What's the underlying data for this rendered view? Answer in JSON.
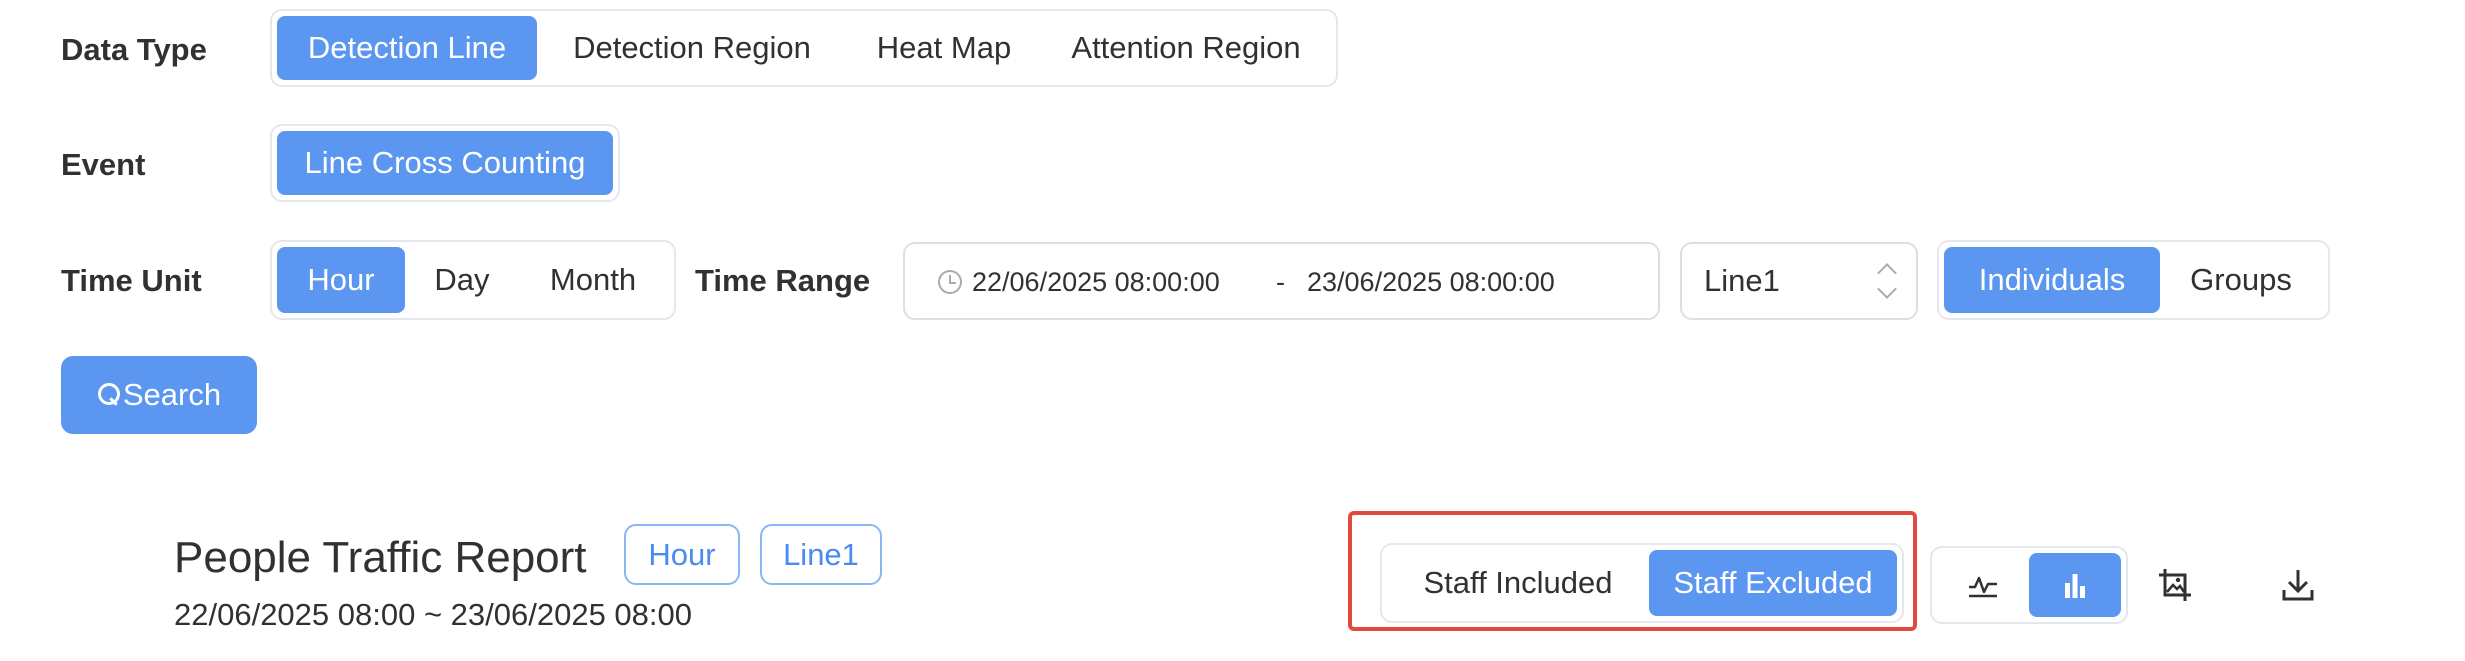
{
  "filters": {
    "data_type": {
      "label": "Data Type",
      "options": [
        "Detection Line",
        "Detection Region",
        "Heat Map",
        "Attention Region"
      ],
      "selected": "Detection Line"
    },
    "event": {
      "label": "Event",
      "options": [
        "Line Cross Counting"
      ],
      "selected": "Line Cross Counting"
    },
    "time_unit": {
      "label": "Time Unit",
      "options": [
        "Hour",
        "Day",
        "Month"
      ],
      "selected": "Hour"
    },
    "time_range": {
      "label": "Time Range",
      "start": "22/06/2025 08:00:00",
      "separator": "-",
      "end": "23/06/2025 08:00:00"
    },
    "line_select": {
      "value": "Line1"
    },
    "grouping": {
      "options": [
        "Individuals",
        "Groups"
      ],
      "selected": "Individuals"
    },
    "search_label": "Search"
  },
  "report": {
    "title": "People Traffic Report",
    "tags": [
      "Hour",
      "Line1"
    ],
    "range": "22/06/2025 08:00 ~ 23/06/2025 08:00",
    "staff_toggle": {
      "options": [
        "Staff Included",
        "Staff Excluded"
      ],
      "selected": "Staff Excluded"
    },
    "chart_type": {
      "selected": "bar"
    }
  },
  "colors": {
    "accent": "#5b96f0",
    "highlight_border": "#e14b3f",
    "text": "#303133",
    "border": "#e4e7ed"
  },
  "icons": [
    "clock-icon",
    "chevron-up-icon",
    "chevron-down-icon",
    "search-icon",
    "line-chart-icon",
    "bar-chart-icon",
    "save-image-icon",
    "download-icon"
  ]
}
